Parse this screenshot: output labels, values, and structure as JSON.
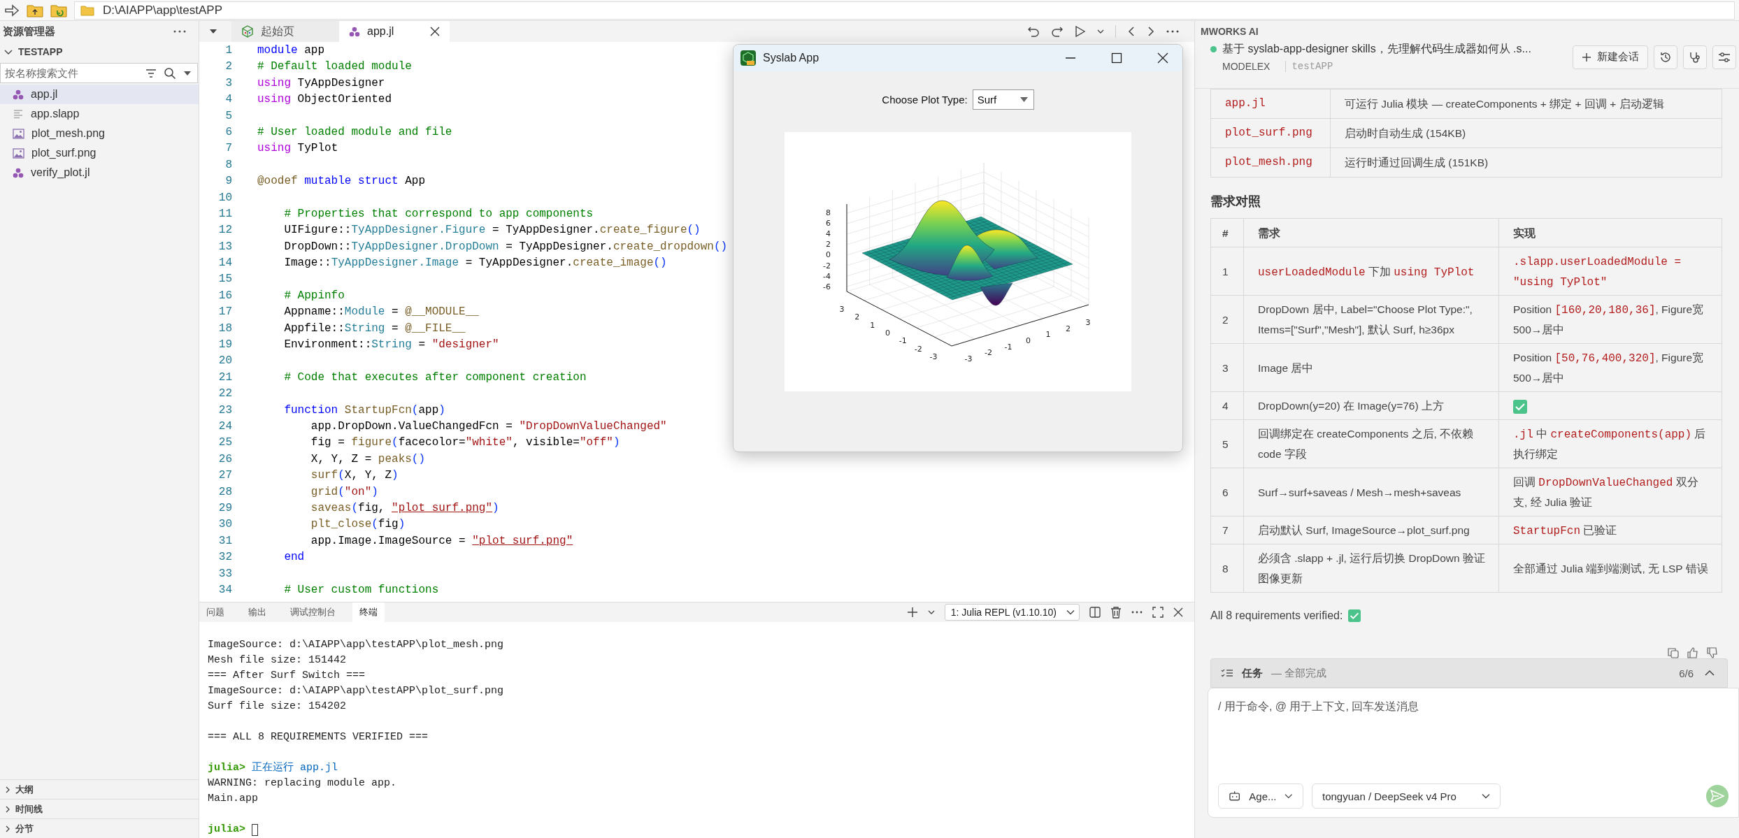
{
  "address_bar": {
    "path": "D:\\AIAPP\\app\\testAPP"
  },
  "sidebar": {
    "title": "资源管理器",
    "folder": {
      "name": "TESTAPP",
      "expanded": true
    },
    "search": {
      "placeholder": "按名称搜索文件"
    },
    "files": [
      {
        "name": "app.jl",
        "kind": "julia",
        "selected": true
      },
      {
        "name": "app.slapp",
        "kind": "text",
        "selected": false
      },
      {
        "name": "plot_mesh.png",
        "kind": "image",
        "selected": false
      },
      {
        "name": "plot_surf.png",
        "kind": "image",
        "selected": false
      },
      {
        "name": "verify_plot.jl",
        "kind": "julia",
        "selected": false
      }
    ],
    "sections": [
      {
        "label": "大纲",
        "expanded": false
      },
      {
        "label": "时间线",
        "expanded": false
      },
      {
        "label": "分节",
        "expanded": false
      }
    ]
  },
  "editor": {
    "tabs": [
      {
        "label": "起始页",
        "kind": "start",
        "selected": false
      },
      {
        "label": "app.jl",
        "kind": "julia",
        "selected": true
      }
    ],
    "lines": [
      {
        "number": "1",
        "tokens": [
          {
            "kind": "kw",
            "text": "module"
          },
          {
            "kind": "pl",
            "text": " app"
          }
        ]
      },
      {
        "number": "2",
        "tokens": [
          {
            "kind": "com",
            "text": "# Default loaded module"
          }
        ]
      },
      {
        "number": "3",
        "tokens": [
          {
            "kind": "imp",
            "text": "using"
          },
          {
            "kind": "pl",
            "text": " TyAppDesigner"
          }
        ]
      },
      {
        "number": "4",
        "tokens": [
          {
            "kind": "imp",
            "text": "using"
          },
          {
            "kind": "pl",
            "text": " ObjectOriented"
          }
        ]
      },
      {
        "number": "5"
      },
      {
        "number": "6",
        "tokens": [
          {
            "kind": "com",
            "text": "# User loaded module and file"
          }
        ]
      },
      {
        "number": "7",
        "tokens": [
          {
            "kind": "imp",
            "text": "using"
          },
          {
            "kind": "pl",
            "text": " TyPlot"
          }
        ]
      },
      {
        "number": "8"
      },
      {
        "number": "9",
        "tokens": [
          {
            "kind": "fn",
            "text": "@oodef"
          },
          {
            "kind": "kw",
            "text": " mutable struct"
          },
          {
            "kind": "pl",
            "text": " App"
          }
        ]
      },
      {
        "number": "10"
      },
      {
        "number": "11",
        "tokens": [
          {
            "kind": "com",
            "text": "    # Properties that correspond to app components"
          }
        ]
      },
      {
        "number": "12",
        "tokens": [
          {
            "kind": "pl",
            "text": "    UIFigure::"
          },
          {
            "kind": "typ",
            "text": "TyAppDesigner.Figure"
          },
          {
            "kind": "pl",
            "text": " = TyAppDesigner."
          },
          {
            "kind": "fn",
            "text": "create_figure"
          },
          {
            "kind": "br",
            "text": "()"
          }
        ]
      },
      {
        "number": "13",
        "tokens": [
          {
            "kind": "pl",
            "text": "    DropDown::"
          },
          {
            "kind": "typ",
            "text": "TyAppDesigner.DropDown"
          },
          {
            "kind": "pl",
            "text": " = TyAppDesigner."
          },
          {
            "kind": "fn",
            "text": "create_dropdown"
          },
          {
            "kind": "br",
            "text": "()"
          }
        ]
      },
      {
        "number": "14",
        "tokens": [
          {
            "kind": "pl",
            "text": "    Image::"
          },
          {
            "kind": "typ",
            "text": "TyAppDesigner.Image"
          },
          {
            "kind": "pl",
            "text": " = TyAppDesigner."
          },
          {
            "kind": "fn",
            "text": "create_image"
          },
          {
            "kind": "br",
            "text": "()"
          }
        ]
      },
      {
        "number": "15"
      },
      {
        "number": "16",
        "tokens": [
          {
            "kind": "com",
            "text": "    # Appinfo"
          }
        ]
      },
      {
        "number": "17",
        "tokens": [
          {
            "kind": "pl",
            "text": "    Appname::"
          },
          {
            "kind": "typ",
            "text": "Module"
          },
          {
            "kind": "pl",
            "text": " = "
          },
          {
            "kind": "fn",
            "text": "@__MODULE__"
          }
        ]
      },
      {
        "number": "18",
        "tokens": [
          {
            "kind": "pl",
            "text": "    Appfile::"
          },
          {
            "kind": "typ",
            "text": "String"
          },
          {
            "kind": "pl",
            "text": " = "
          },
          {
            "kind": "fn",
            "text": "@__FILE__"
          }
        ]
      },
      {
        "number": "19",
        "tokens": [
          {
            "kind": "pl",
            "text": "    Environment::"
          },
          {
            "kind": "typ",
            "text": "String"
          },
          {
            "kind": "pl",
            "text": " = "
          },
          {
            "kind": "str",
            "text": "\"designer\""
          }
        ]
      },
      {
        "number": "20"
      },
      {
        "number": "21",
        "tokens": [
          {
            "kind": "com",
            "text": "    # Code that executes after component creation"
          }
        ]
      },
      {
        "number": "22"
      },
      {
        "number": "23",
        "tokens": [
          {
            "kind": "kw",
            "text": "    function"
          },
          {
            "kind": "fn",
            "text": " StartupFcn"
          },
          {
            "kind": "br",
            "text": "("
          },
          {
            "kind": "pl",
            "text": "app"
          },
          {
            "kind": "br",
            "text": ")"
          }
        ]
      },
      {
        "number": "24",
        "tokens": [
          {
            "kind": "pl",
            "text": "        app.DropDown.ValueChangedFcn = "
          },
          {
            "kind": "str",
            "text": "\"DropDownValueChanged\""
          }
        ]
      },
      {
        "number": "25",
        "tokens": [
          {
            "kind": "pl",
            "text": "        fig = "
          },
          {
            "kind": "fn",
            "text": "figure"
          },
          {
            "kind": "br",
            "text": "("
          },
          {
            "kind": "pl",
            "text": "facecolor="
          },
          {
            "kind": "str",
            "text": "\"white\""
          },
          {
            "kind": "pl",
            "text": ", visible="
          },
          {
            "kind": "str",
            "text": "\"off\""
          },
          {
            "kind": "br",
            "text": ")"
          }
        ]
      },
      {
        "number": "26",
        "tokens": [
          {
            "kind": "pl",
            "text": "        X, Y, Z = "
          },
          {
            "kind": "fn",
            "text": "peaks"
          },
          {
            "kind": "br",
            "text": "()"
          }
        ]
      },
      {
        "number": "27",
        "tokens": [
          {
            "kind": "fn",
            "text": "        surf"
          },
          {
            "kind": "br",
            "text": "("
          },
          {
            "kind": "pl",
            "text": "X, Y, Z"
          },
          {
            "kind": "br",
            "text": ")"
          }
        ]
      },
      {
        "number": "28",
        "tokens": [
          {
            "kind": "fn",
            "text": "        grid"
          },
          {
            "kind": "br",
            "text": "("
          },
          {
            "kind": "str",
            "text": "\"on\""
          },
          {
            "kind": "br",
            "text": ")"
          }
        ]
      },
      {
        "number": "29",
        "tokens": [
          {
            "kind": "fn",
            "text": "        saveas"
          },
          {
            "kind": "br",
            "text": "("
          },
          {
            "kind": "pl",
            "text": "fig, "
          },
          {
            "kind": "lnk",
            "text": "\"plot_surf.png\""
          },
          {
            "kind": "br",
            "text": ")"
          }
        ]
      },
      {
        "number": "30",
        "tokens": [
          {
            "kind": "fn",
            "text": "        plt_close"
          },
          {
            "kind": "br",
            "text": "("
          },
          {
            "kind": "pl",
            "text": "fig"
          },
          {
            "kind": "br",
            "text": ")"
          }
        ]
      },
      {
        "number": "31",
        "tokens": [
          {
            "kind": "pl",
            "text": "        app.Image.ImageSource = "
          },
          {
            "kind": "lnk",
            "text": "\"plot_surf.png\""
          }
        ]
      },
      {
        "number": "32",
        "tokens": [
          {
            "kind": "kw",
            "text": "    end"
          }
        ]
      },
      {
        "number": "33"
      },
      {
        "number": "34",
        "tokens": [
          {
            "kind": "com",
            "text": "    # User custom functions"
          }
        ]
      }
    ]
  },
  "panel": {
    "tabs": [
      {
        "label": "问题",
        "selected": false
      },
      {
        "label": "输出",
        "selected": false
      },
      {
        "label": "调试控制台",
        "selected": false
      },
      {
        "label": "终端",
        "selected": true
      }
    ],
    "terminal_selector": "1: Julia REPL (v1.10.10)",
    "terminal_lines": [
      {
        "kind": "output",
        "text": "ImageSource: d:\\AIAPP\\app\\testAPP\\plot_mesh.png"
      },
      {
        "kind": "output",
        "text": "Mesh file size: 151442"
      },
      {
        "kind": "output",
        "text": "=== After Surf Switch ==="
      },
      {
        "kind": "output",
        "text": "ImageSource: d:\\AIAPP\\app\\testAPP\\plot_surf.png"
      },
      {
        "kind": "output",
        "text": "Surf file size: 154202"
      },
      {
        "kind": "blank"
      },
      {
        "kind": "output",
        "text": "=== ALL 8 REQUIREMENTS VERIFIED ==="
      },
      {
        "kind": "blank"
      },
      {
        "kind": "prompt",
        "prompt": "julia>",
        "text": "正在运行 app.jl"
      },
      {
        "kind": "output",
        "text": "WARNING: replacing module app."
      },
      {
        "kind": "output",
        "text": "Main.app"
      },
      {
        "kind": "blank"
      },
      {
        "kind": "input",
        "prompt": "julia>"
      }
    ]
  },
  "syslab_window": {
    "title": "Syslab App",
    "dropdown": {
      "label": "Choose Plot Type:",
      "value": "Surf"
    },
    "plot": {
      "z_ticks": [
        "8",
        "6",
        "4",
        "2",
        "0",
        "-2",
        "-4",
        "-6"
      ],
      "y_ticks": [
        "3",
        "2",
        "1",
        "0",
        "-1",
        "-2",
        "-3"
      ],
      "x_ticks": [
        "-3",
        "-2",
        "-1",
        "0",
        "1",
        "2",
        "3"
      ]
    }
  },
  "ai_panel": {
    "title": "MWORKS AI",
    "session": {
      "title": "基于 syslab-app-designer skills，先理解代码生成器如何从 .s...",
      "model": "MODELEX",
      "project": "testAPP"
    },
    "new_chat": "新建会话",
    "files_table": [
      {
        "file": "app.jl",
        "description": "可运行 Julia 模块 — createComponents + 绑定 + 回调 + 启动逻辑"
      },
      {
        "file": "plot_surf.png",
        "description": "启动时自动生成 (154KB)"
      },
      {
        "file": "plot_mesh.png",
        "description": "运行时通过回调生成 (151KB)"
      }
    ],
    "requirements": {
      "heading": "需求对照",
      "columns": [
        "#",
        "需求",
        "实现"
      ],
      "rows": [
        {
          "number": "1",
          "requirement": [
            {
              "kind": "code",
              "text": "userLoadedModule"
            },
            {
              "kind": "text",
              "text": " 下加 "
            },
            {
              "kind": "code",
              "text": "using TyPlot"
            }
          ],
          "implementation": [
            {
              "kind": "code",
              "text": ".slapp.userLoadedModule = \"using TyPlot\""
            }
          ]
        },
        {
          "number": "2",
          "requirement": [
            {
              "kind": "text",
              "text": "DropDown 居中, Label=\"Choose Plot Type:\", Items=[\"Surf\",\"Mesh\"], 默认 Surf, h≥36px"
            }
          ],
          "implementation": [
            {
              "kind": "text",
              "text": "Position "
            },
            {
              "kind": "code",
              "text": "[160,20,180,36]"
            },
            {
              "kind": "text",
              "text": ", Figure宽500→居中"
            }
          ]
        },
        {
          "number": "3",
          "requirement": [
            {
              "kind": "text",
              "text": "Image 居中"
            }
          ],
          "implementation": [
            {
              "kind": "text",
              "text": "Position "
            },
            {
              "kind": "code",
              "text": "[50,76,400,320]"
            },
            {
              "kind": "text",
              "text": ", Figure宽500→居中"
            }
          ]
        },
        {
          "number": "4",
          "requirement": [
            {
              "kind": "text",
              "text": "DropDown(y=20) 在 Image(y=76) 上方"
            }
          ],
          "implementation": [
            {
              "kind": "check"
            }
          ]
        },
        {
          "number": "5",
          "requirement": [
            {
              "kind": "text",
              "text": "回调绑定在 createComponents 之后, 不依赖 code 字段"
            }
          ],
          "implementation": [
            {
              "kind": "code",
              "text": ".jl"
            },
            {
              "kind": "text",
              "text": " 中 "
            },
            {
              "kind": "code",
              "text": "createComponents(app)"
            },
            {
              "kind": "text",
              "text": " 后执行绑定"
            }
          ]
        },
        {
          "number": "6",
          "requirement": [
            {
              "kind": "text",
              "text": "Surf→surf+saveas / Mesh→mesh+saveas"
            }
          ],
          "implementation": [
            {
              "kind": "text",
              "text": "回调 "
            },
            {
              "kind": "code",
              "text": "DropDownValueChanged"
            },
            {
              "kind": "text",
              "text": " 双分支, 经 Julia 验证"
            }
          ]
        },
        {
          "number": "7",
          "requirement": [
            {
              "kind": "text",
              "text": "启动默认 Surf, ImageSource→plot_surf.png"
            }
          ],
          "implementation": [
            {
              "kind": "code",
              "text": "StartupFcn"
            },
            {
              "kind": "text",
              "text": " 已验证"
            }
          ]
        },
        {
          "number": "8",
          "requirement": [
            {
              "kind": "text",
              "text": "必须含 .slapp + .jl, 运行后切换 DropDown 验证图像更新"
            }
          ],
          "implementation": [
            {
              "kind": "text",
              "text": "全部通过 Julia 端到端测试, 无 LSP 错误"
            }
          ]
        }
      ]
    },
    "summary": "All 8 requirements verified:",
    "tasks": {
      "title": "任务",
      "status": "— 全部完成",
      "count": "6/6",
      "expanded": true
    },
    "composer": {
      "placeholder": "/ 用于命令, @ 用于上下文, 回车发送消息",
      "agent": "Age...",
      "model": "tongyuan / DeepSeek v4 Pro"
    }
  }
}
